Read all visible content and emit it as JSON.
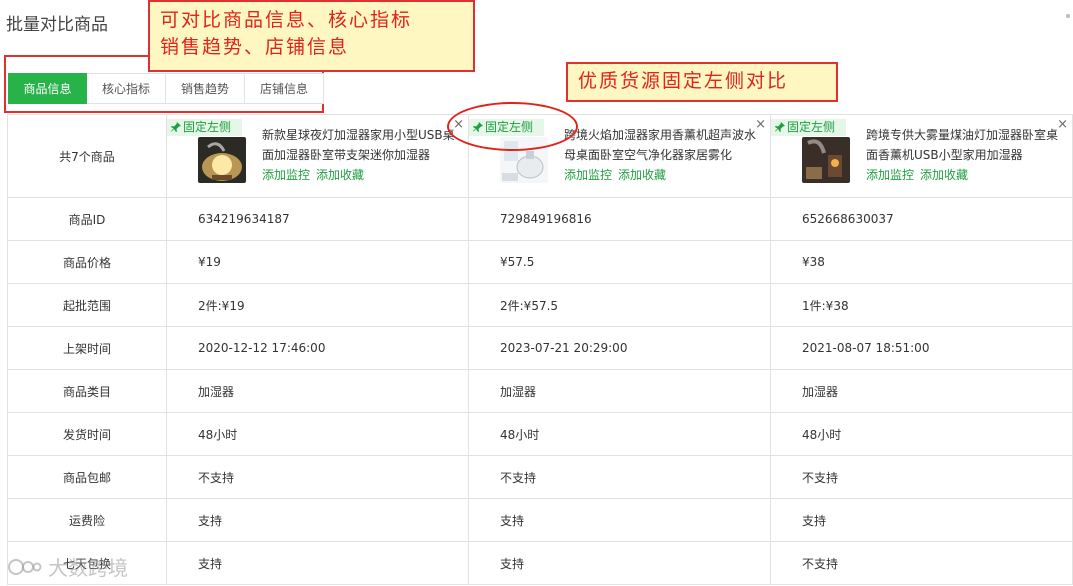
{
  "page": {
    "title": "批量对比商品"
  },
  "callouts": {
    "top_line1": "可对比商品信息、核心指标",
    "top_line2": "销售趋势、店铺信息",
    "right": "优质货源固定左侧对比"
  },
  "tabs": [
    {
      "label": "商品信息",
      "active": true
    },
    {
      "label": "核心指标",
      "active": false
    },
    {
      "label": "销售趋势",
      "active": false
    },
    {
      "label": "店铺信息",
      "active": false
    }
  ],
  "compare": {
    "count_label": "共7个商品",
    "pin_label": "固定左侧",
    "close_glyph": "×",
    "link_monitor": "添加监控",
    "link_favorite": "添加收藏",
    "products": [
      {
        "title": "新款星球夜灯加湿器家用小型USB桌面加湿器卧室带支架迷你加湿器",
        "thumb": "humidifier-planet"
      },
      {
        "title": "跨境火焰加湿器家用香薰机超声波水母桌面卧室空气净化器家居雾化",
        "thumb": "humidifier-flame"
      },
      {
        "title": "跨境专供大雾量煤油灯加湿器卧室桌面香薰机USB小型家用加湿器",
        "thumb": "humidifier-lamp"
      }
    ],
    "rows": [
      {
        "label": "商品ID",
        "values": [
          "634219634187",
          "729849196816",
          "652668630037"
        ]
      },
      {
        "label": "商品价格",
        "values": [
          "¥19",
          "¥57.5",
          "¥38"
        ]
      },
      {
        "label": "起批范围",
        "values": [
          "2件:¥19",
          "2件:¥57.5",
          "1件:¥38"
        ]
      },
      {
        "label": "上架时间",
        "values": [
          "2020-12-12 17:46:00",
          "2023-07-21 20:29:00",
          "2021-08-07 18:51:00"
        ]
      },
      {
        "label": "商品类目",
        "values": [
          "加湿器",
          "加湿器",
          "加湿器"
        ]
      },
      {
        "label": "发货时间",
        "values": [
          "48小时",
          "48小时",
          "48小时"
        ]
      },
      {
        "label": "商品包邮",
        "values": [
          "不支持",
          "不支持",
          "不支持"
        ]
      },
      {
        "label": "运费险",
        "values": [
          "支持",
          "支持",
          "支持"
        ]
      },
      {
        "label": "七天包换",
        "values": [
          "支持",
          "支持",
          "不支持"
        ]
      }
    ]
  },
  "watermark": {
    "text": "大数跨境"
  },
  "colors": {
    "accent": "#27b24a",
    "link": "#1f9e3f",
    "highlight": "#e0231b",
    "callout_bg": "#fff7c2"
  }
}
